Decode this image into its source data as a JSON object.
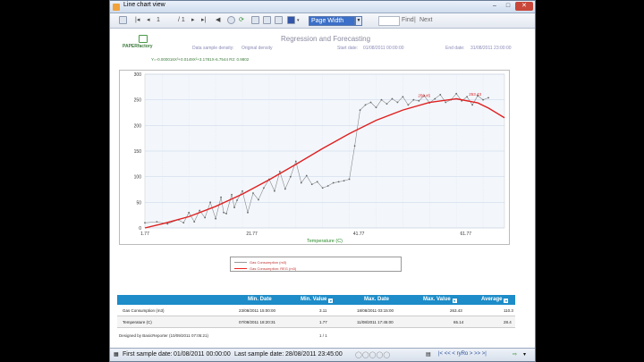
{
  "window": {
    "title": "Line chart view"
  },
  "toolbar": {
    "page_current": "1",
    "page_total": "/ 1",
    "zoom": "Page Width",
    "find": "Find",
    "next": "Next"
  },
  "report": {
    "logo": "PAPERfactory",
    "title": "Regression and Forecasting",
    "density_label": "Data sample density:",
    "density_value": "Original density",
    "start_label": "Start date:",
    "start_value": "01/08/2011 00:00:00",
    "end_label": "End date:",
    "end_value": "31/08/2011 23:00:00",
    "equation": "Y=-0.000016X³+0.0149X²+3.1781X-6.7544    R2: 0.9802"
  },
  "chart_data": {
    "type": "line",
    "xlabel": "Temperature (C)",
    "x_ticks": [
      "1.77",
      "21.77",
      "41.77",
      "61.77"
    ],
    "y_ticks": [
      "0",
      "50",
      "100",
      "150",
      "200",
      "250",
      "300"
    ],
    "xlim": [
      1.77,
      69
    ],
    "ylim": [
      0,
      300
    ],
    "grid": true,
    "legend_position": "bottom",
    "annotations": [
      {
        "text": "250.45",
        "x": 54,
        "y": 250
      },
      {
        "text": "253.43",
        "x": 63.5,
        "y": 253
      }
    ],
    "series": [
      {
        "name": "Gas Consumption (m3)",
        "color": "#888888",
        "x": [
          1.77,
          4,
          6,
          8,
          9,
          10,
          11,
          12,
          13,
          14,
          15,
          16,
          16.5,
          17,
          18,
          18.5,
          19,
          20,
          21,
          22,
          23,
          24,
          25,
          26,
          27,
          28,
          29,
          30,
          31,
          32,
          33,
          34,
          35,
          36,
          37,
          38,
          39,
          40,
          41,
          42,
          43,
          44,
          45,
          46,
          47,
          48,
          49,
          50,
          51,
          52,
          53,
          54,
          55,
          56,
          57,
          58,
          59,
          60,
          61,
          62,
          63,
          64,
          65,
          66
        ],
        "y": [
          10,
          12,
          8,
          16,
          10,
          30,
          12,
          34,
          20,
          50,
          18,
          60,
          30,
          28,
          65,
          40,
          54,
          72,
          30,
          68,
          55,
          78,
          95,
          72,
          110,
          76,
          100,
          130,
          88,
          102,
          85,
          90,
          78,
          82,
          88,
          90,
          92,
          95,
          160,
          230,
          240,
          245,
          235,
          250,
          242,
          252,
          245,
          256,
          240,
          250,
          248,
          258,
          244,
          252,
          260,
          245,
          250,
          262,
          248,
          256,
          240,
          258,
          250,
          254
        ]
      },
      {
        "name": "Gas Consumption: REG (m3)",
        "color": "#e02020",
        "x": [
          1.77,
          5,
          10,
          15,
          20,
          25,
          30,
          35,
          40,
          45,
          50,
          55,
          60,
          64,
          66,
          69
        ],
        "y": [
          0,
          8,
          22,
          42,
          66,
          94,
          124,
          155,
          184,
          210,
          230,
          245,
          252,
          244,
          234,
          215
        ]
      }
    ]
  },
  "stats": {
    "headers": [
      "Min. Date",
      "Min. Value",
      "Max. Date",
      "Max. Value",
      "Average"
    ],
    "rows": [
      {
        "label": "Gas Consumption (m3)",
        "min_date": "23/08/2011 15:00:00",
        "min_value": "3.11",
        "max_date": "18/08/2011 03:15:00",
        "max_value": "263.43",
        "average": "110.3"
      },
      {
        "label": "Temperature (C)",
        "min_date": "07/08/2011 18:20:31",
        "min_value": "1.77",
        "max_date": "11/08/2011 17:45:00",
        "max_value": "65.14",
        "average": "28.4"
      }
    ]
  },
  "footer": {
    "designed": "Designed by  BasicReporter  (10/09/2011 07:05:21)",
    "page": "1 / 1"
  },
  "status": {
    "first_label": "First sample date:",
    "first_value": "01/08/2011 00:00:00",
    "last_label": "Last sample date:",
    "last_value": "28/08/2011 23:45:00",
    "nav": "|< << < ryRo > >> >|"
  }
}
